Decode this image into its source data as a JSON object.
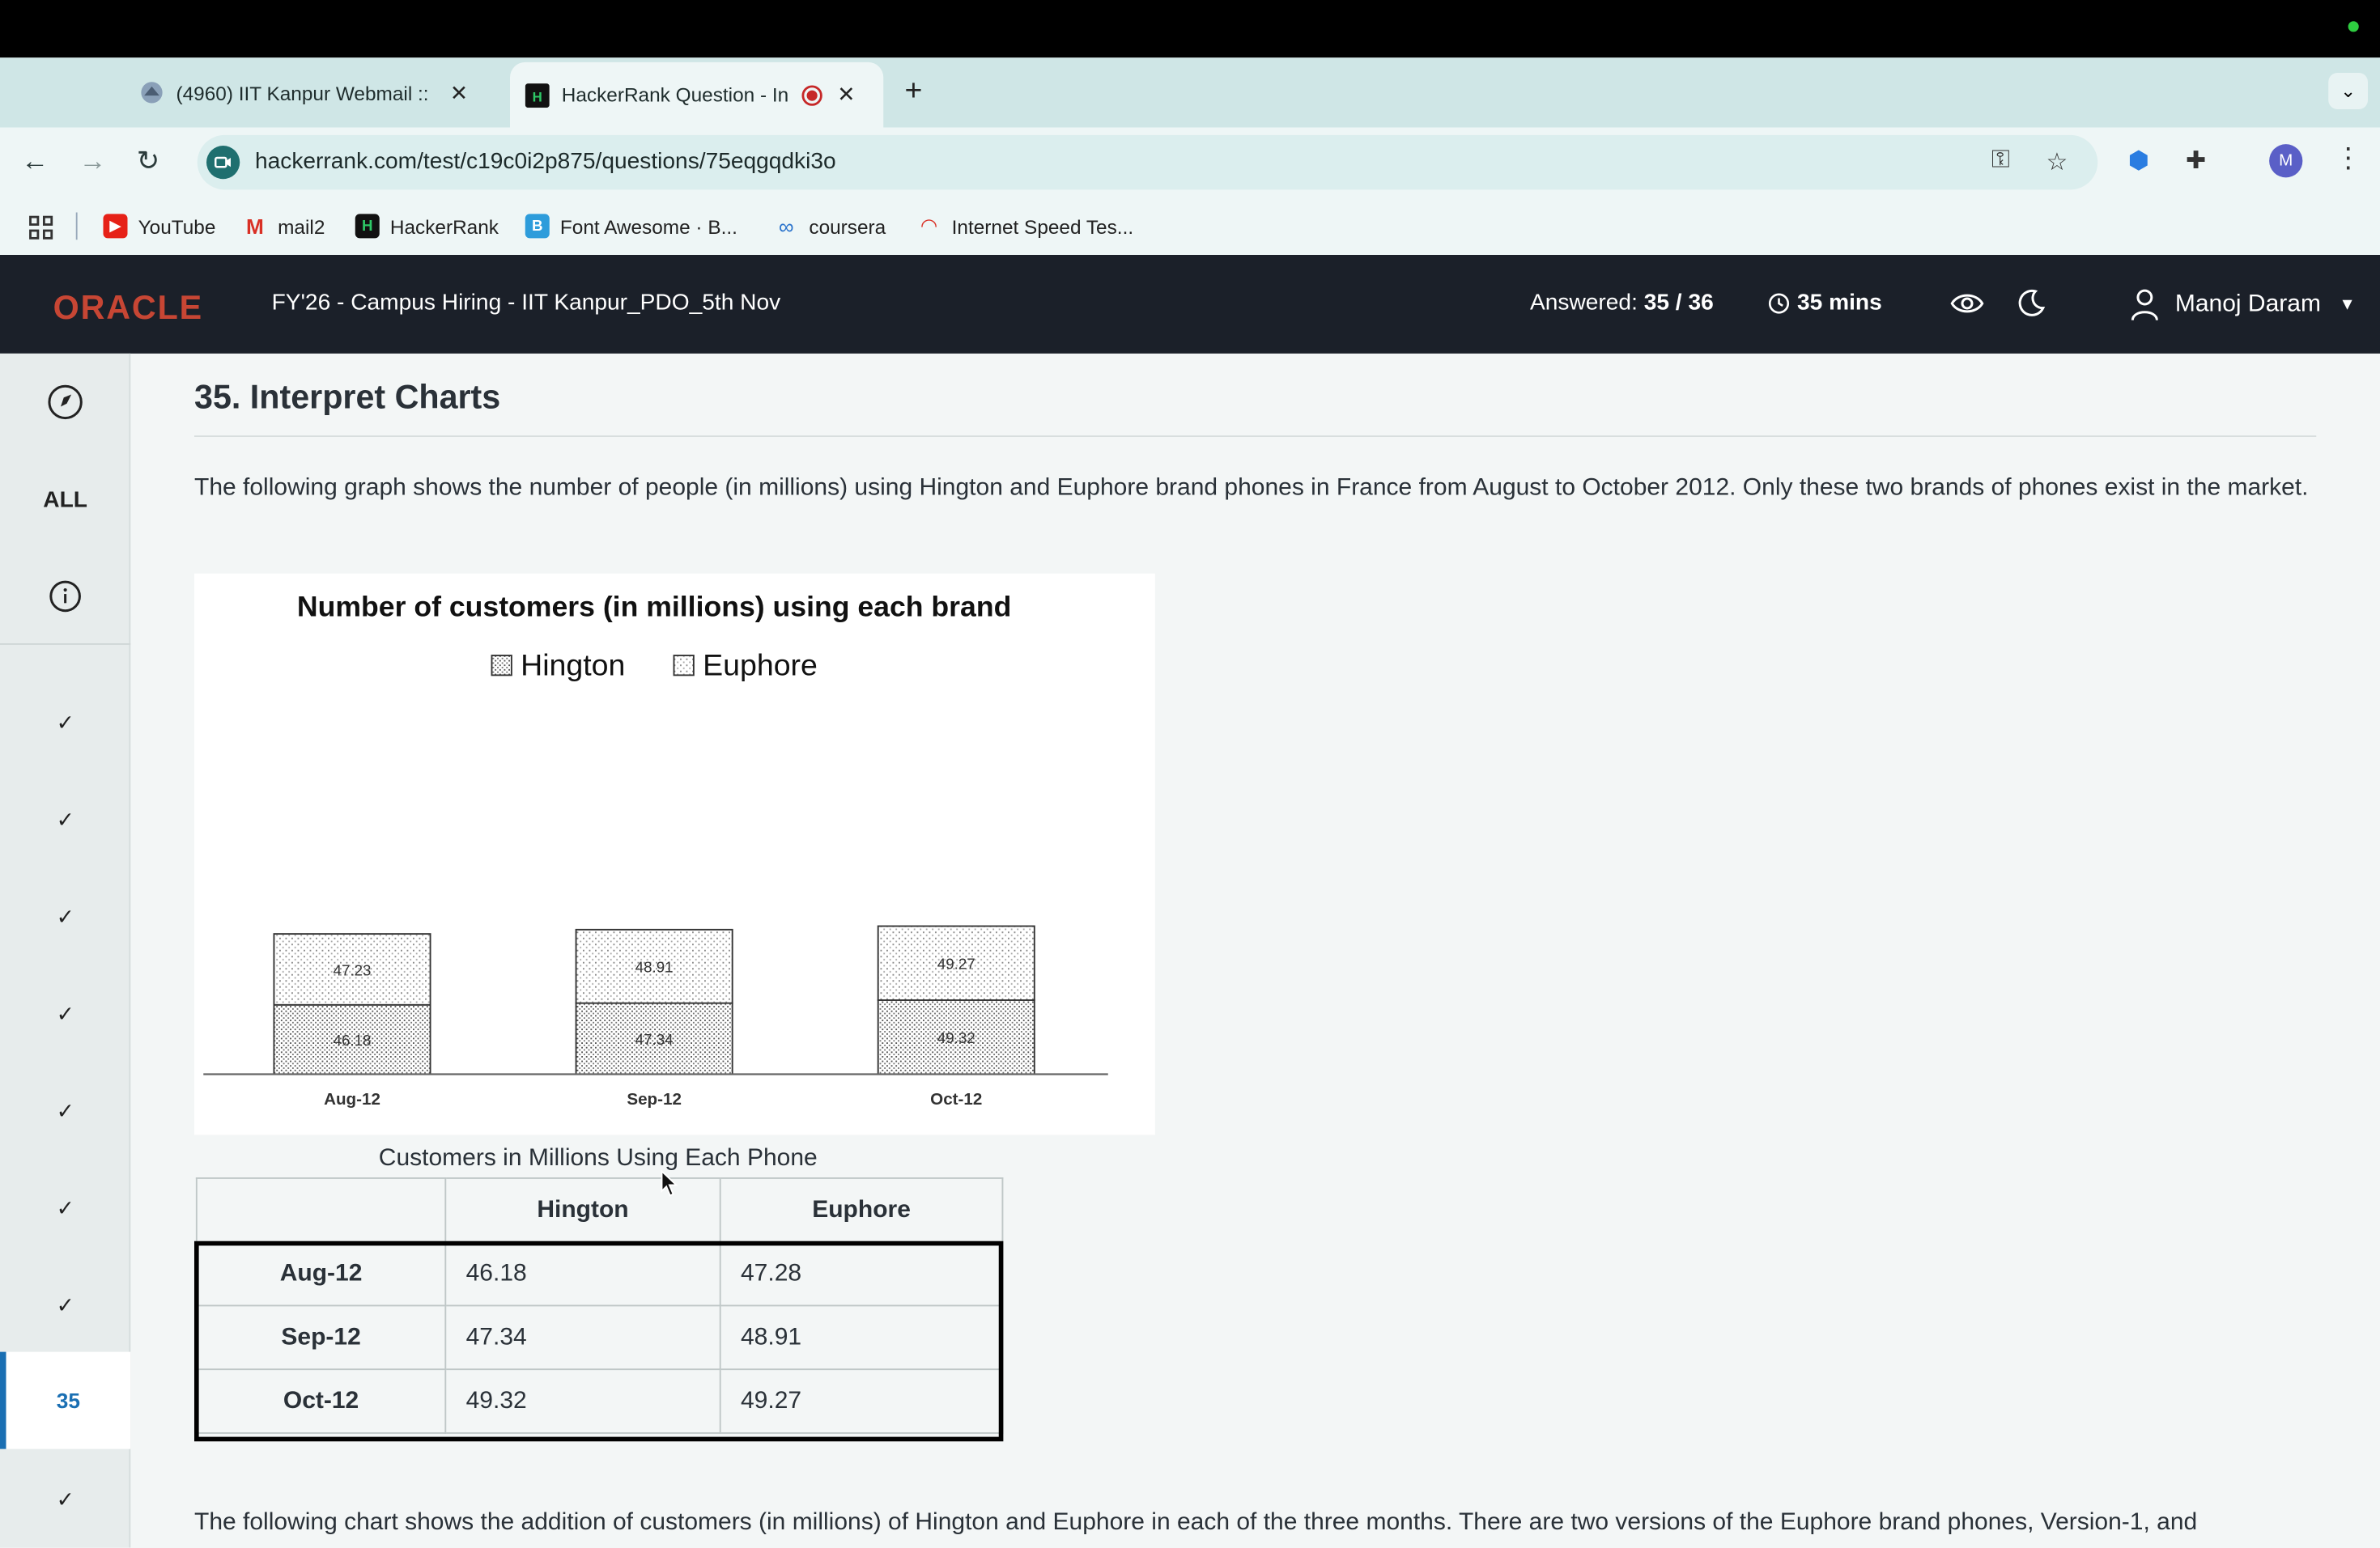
{
  "browser": {
    "tabs": [
      {
        "label": "(4960) IIT Kanpur Webmail ::",
        "active": false
      },
      {
        "label": "HackerRank Question - In",
        "active": true
      }
    ],
    "url": "hackerrank.com/test/c19c0i2p875/questions/75eqgqdki3o",
    "profile_initial": "M",
    "bookmarks": [
      "YouTube",
      "mail2",
      "HackerRank",
      "Font Awesome · B...",
      "coursera",
      "Internet Speed Tes..."
    ]
  },
  "header": {
    "logo": "ORACLE",
    "test_name": "FY'26 - Campus Hiring - IIT Kanpur_PDO_5th Nov",
    "answered_label": "Answered:",
    "answered_value": "35 / 36",
    "timer": "35 mins",
    "user_name": "Manoj Daram"
  },
  "sidebar": {
    "all_label": "ALL",
    "current": "35",
    "check": "✓"
  },
  "question": {
    "title": "35. Interpret Charts",
    "text": "The following graph shows the number of people (in millions) using Hington and Euphore brand phones in France from August to October 2012. Only these two brands of phones exist in the market.",
    "footer_text": "The following chart shows the addition of customers (in millions) of Hington and Euphore in each of the three months. There are two versions of the Euphore brand phones, Version-1, and"
  },
  "chart_data": {
    "type": "bar",
    "stacked": true,
    "title": "Number of customers (in millions) using each brand",
    "categories": [
      "Aug-12",
      "Sep-12",
      "Oct-12"
    ],
    "series": [
      {
        "name": "Hington",
        "values": [
          46.18,
          47.34,
          49.32
        ],
        "labels": [
          "46.18",
          "47.34",
          "49.32"
        ]
      },
      {
        "name": "Euphore",
        "values": [
          47.23,
          48.91,
          49.27
        ],
        "labels": [
          "47.23",
          "48.91",
          "49.27"
        ]
      }
    ],
    "legend": "top",
    "grid": false,
    "ylim": [
      0,
      100
    ]
  },
  "table": {
    "caption": "Customers in Millions Using Each Phone",
    "headers": [
      "",
      "Hington",
      "Euphore"
    ],
    "rows": [
      [
        "Aug-12",
        "46.18",
        "47.28"
      ],
      [
        "Sep-12",
        "47.34",
        "48.91"
      ],
      [
        "Oct-12",
        "49.32",
        "49.27"
      ]
    ]
  }
}
